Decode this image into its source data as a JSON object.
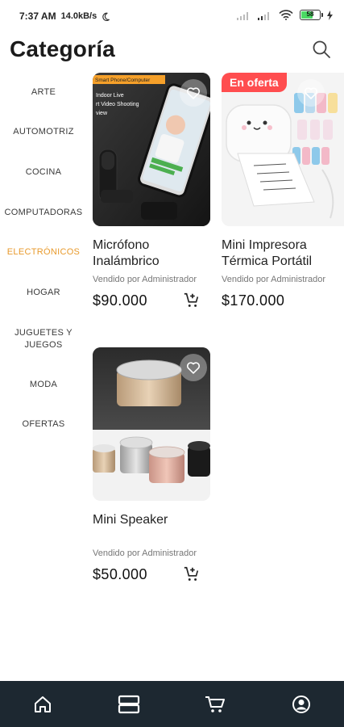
{
  "status_bar": {
    "time": "7:37 AM",
    "network_speed": "14.0kB/s",
    "battery_level": "58"
  },
  "header": {
    "title": "Categoría",
    "search_icon": "search-icon"
  },
  "sidebar": {
    "active_color": "#e89a2c",
    "items": [
      {
        "label": "ARTE",
        "active": false
      },
      {
        "label": "AUTOMOTRIZ",
        "active": false
      },
      {
        "label": "COCINA",
        "active": false
      },
      {
        "label": "COMPUTADORAS",
        "active": false
      },
      {
        "label": "ELECTRÓNICOS",
        "active": true
      },
      {
        "label": "HOGAR",
        "active": false
      },
      {
        "label": "JUGUETES Y JUEGOS",
        "active": false
      },
      {
        "label": "MODA",
        "active": false
      },
      {
        "label": "OFERTAS",
        "active": false
      }
    ]
  },
  "products": [
    {
      "name": "Micrófono Inalámbrico",
      "seller": "Vendido por Administrador",
      "price": "$90.000",
      "badge": "",
      "image_text": [
        "Smart Phone/Computer",
        "Indoor Live",
        "rt Video Shooting",
        "view"
      ]
    },
    {
      "name": "Mini Impresora Térmica Portátil",
      "seller": "Vendido por Administrador",
      "price": "$170.000",
      "badge": "En oferta"
    },
    {
      "name": "Mini Speaker",
      "seller": "Vendido por Administrador",
      "price": "$50.000",
      "badge": ""
    }
  ],
  "bottom_nav": [
    {
      "name": "home-icon"
    },
    {
      "name": "categories-icon"
    },
    {
      "name": "cart-icon"
    },
    {
      "name": "profile-icon"
    }
  ],
  "colors": {
    "accent": "#e89a2c",
    "nav_bg": "#1d2831",
    "badge_bg": "#ff4d4f"
  }
}
